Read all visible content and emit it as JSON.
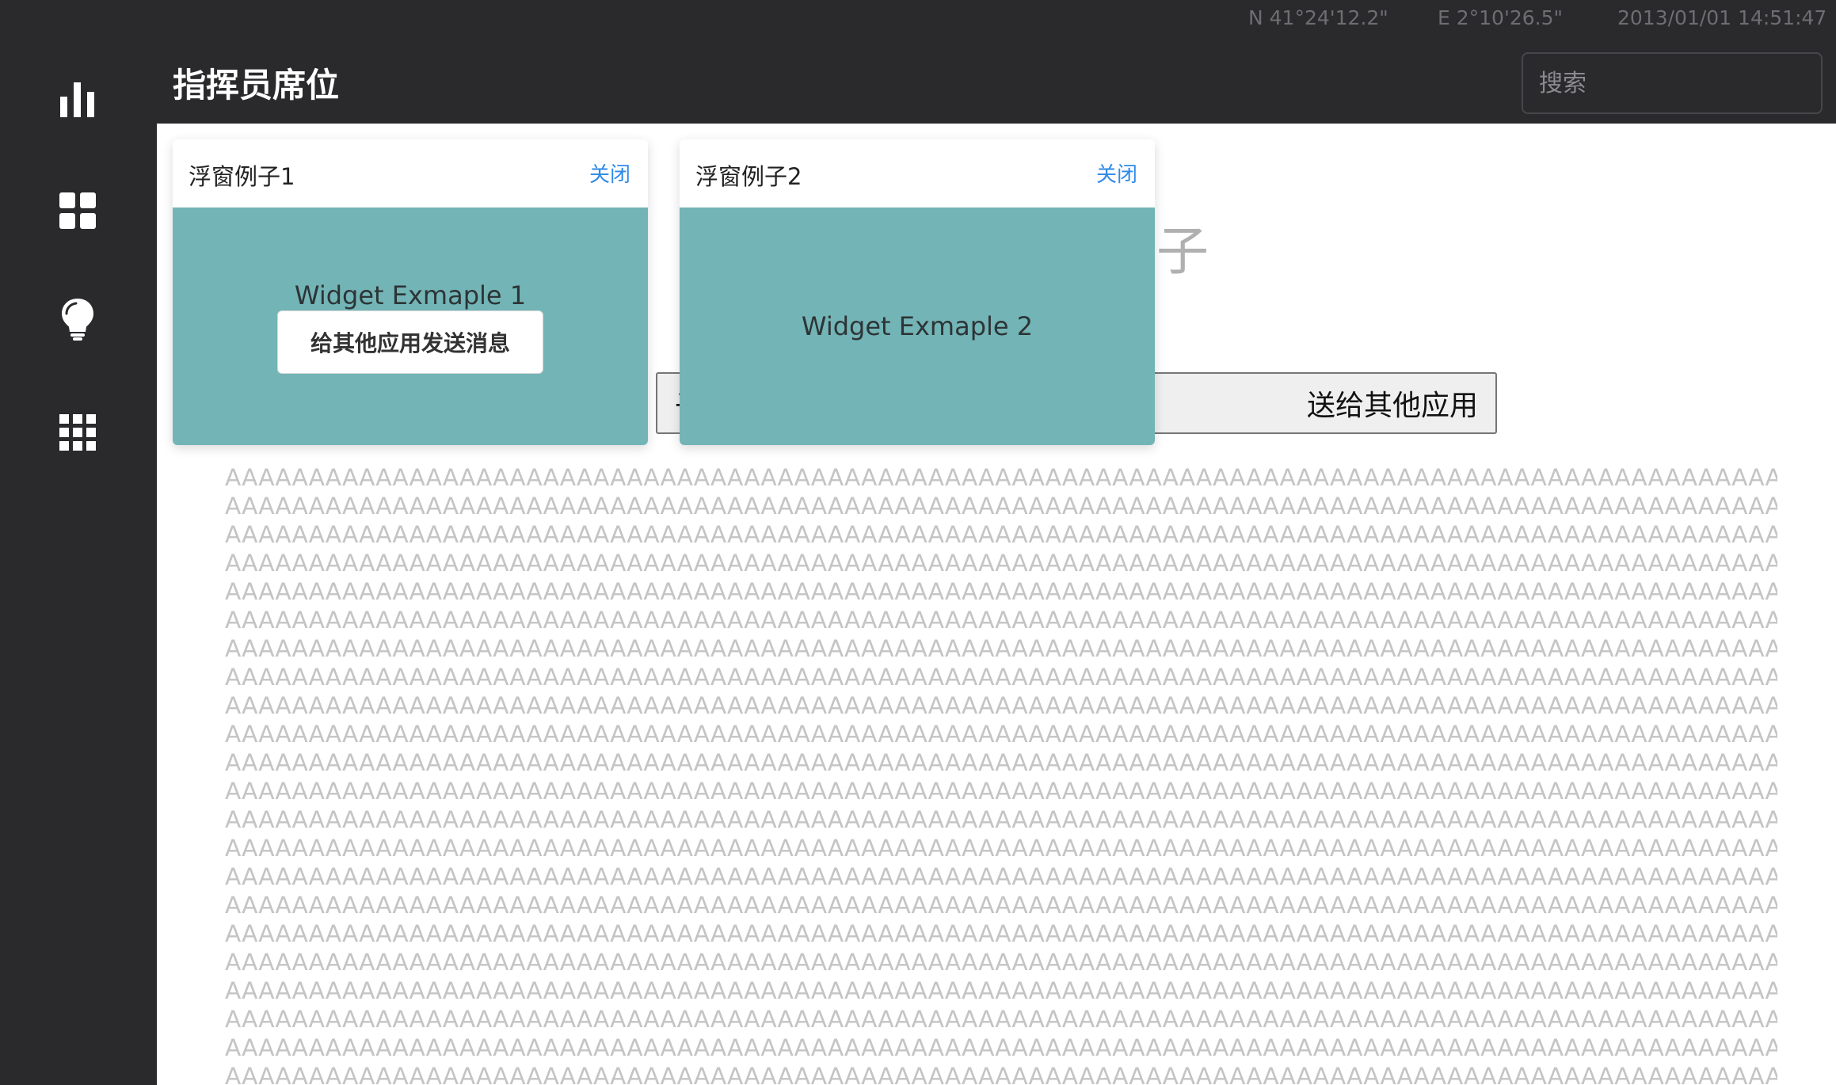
{
  "status": {
    "latitude": "N 41°24'12.2\"",
    "longitude": "E 2°10'26.5\"",
    "datetime": "2013/01/01 14:51:47"
  },
  "header": {
    "title": "指挥员席位",
    "search_placeholder": "搜索"
  },
  "sidebar": {
    "items": [
      {
        "icon": "bar-chart-icon"
      },
      {
        "icon": "dashboard-grid-icon"
      },
      {
        "icon": "lightbulb-icon"
      },
      {
        "icon": "apps-grid-icon"
      }
    ]
  },
  "background": {
    "heading_fragment": "子",
    "button_left_fragment": "子",
    "button_right_fragment": "送给其他应用",
    "filler_text": "AAAAAAAAAAAAAAAAAAAAAAAAAAAAAAAAAAAAAAAAAAAAAAAAAAAAAAAAAAAAAAAAAAAAAAAAAAAAAAAAAAAAAAAAAAAAAAAAAAAAAAAAAAAAAAAA"
  },
  "widgets": [
    {
      "title": "浮窗例子1",
      "close_label": "关闭",
      "content_label": "Widget Exmaple 1",
      "action_label": "给其他应用发送消息"
    },
    {
      "title": "浮窗例子2",
      "close_label": "关闭",
      "content_label": "Widget Exmaple 2"
    }
  ],
  "colors": {
    "sidebar_bg": "#2a2a2c",
    "widget_body": "#73b4b6",
    "link_blue": "#2f8ae8",
    "filler_text": "#c4c4c4"
  }
}
